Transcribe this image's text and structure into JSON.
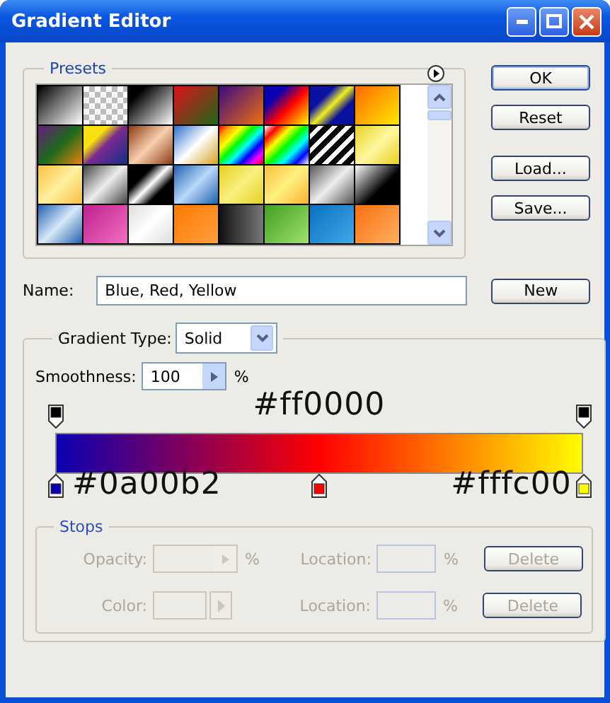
{
  "window": {
    "title": "Gradient Editor"
  },
  "presets": {
    "title": "Presets"
  },
  "buttons": [
    {
      "label": "OK",
      "default": true
    },
    {
      "label": "Reset",
      "default": false
    },
    {
      "label": "Load...",
      "default": false
    },
    {
      "label": "Save...",
      "default": false
    }
  ],
  "name_field": {
    "label": "Name:",
    "value": "Blue, Red, Yellow"
  },
  "new_button": {
    "label": "New"
  },
  "gradient_type": {
    "label": "Gradient Type:",
    "value": "Solid"
  },
  "smoothness": {
    "label": "Smoothness:",
    "value": "100",
    "unit": "%"
  },
  "opacity_stops": [
    {
      "color": "#000000"
    },
    {
      "color": "#000000"
    }
  ],
  "color_stops": [
    {
      "color": "#0a00b2",
      "label": "#0a00b2",
      "kind": "trailing"
    },
    {
      "color": "#ff0000",
      "label": "#ff0000",
      "kind": "overhead"
    },
    {
      "color": "#fffc00",
      "label": "#fffc00",
      "kind": "leading"
    }
  ],
  "stops": {
    "title": "Stops",
    "disabled": true,
    "opacity": {
      "label": "Opacity:",
      "unit": "%"
    },
    "color": {
      "label": "Color:"
    },
    "location_1": {
      "label": "Location:",
      "unit": "%"
    },
    "location_2": {
      "label": "Location:",
      "unit": "%"
    },
    "delete_buttons": [
      "Delete",
      "Delete"
    ]
  }
}
